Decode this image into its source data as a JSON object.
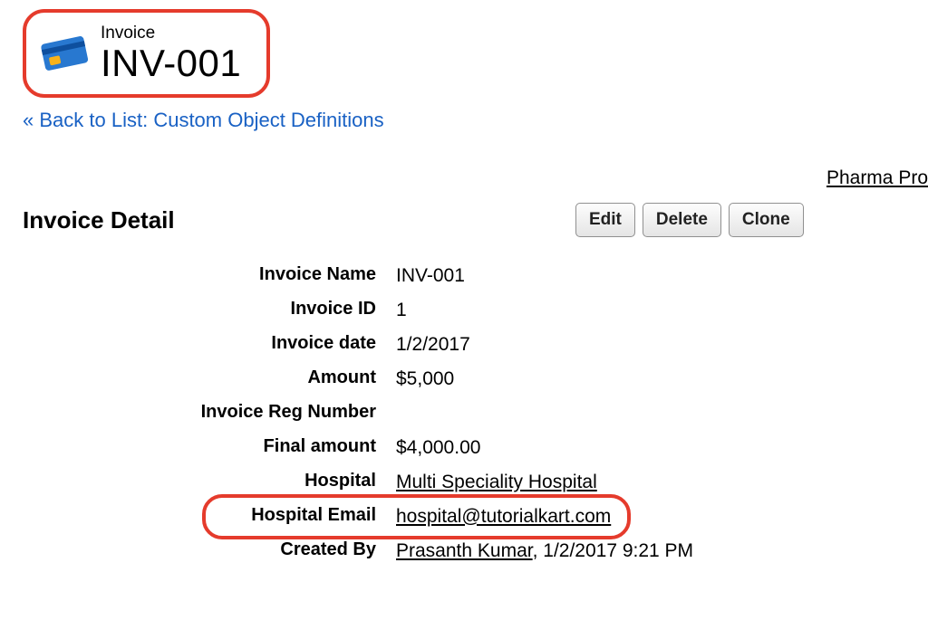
{
  "header": {
    "object_label": "Invoice",
    "record_name": "INV-001"
  },
  "back_link": {
    "chevron": "«",
    "label": "Back to List: Custom Object Definitions"
  },
  "toolbar_link": "Pharma Pro",
  "section_title": "Invoice Detail",
  "buttons": {
    "edit": "Edit",
    "delete": "Delete",
    "clone": "Clone"
  },
  "fields": {
    "invoice_name": {
      "label": "Invoice Name",
      "value": "INV-001"
    },
    "invoice_id": {
      "label": "Invoice ID",
      "value": "1"
    },
    "invoice_date": {
      "label": "Invoice date",
      "value": "1/2/2017"
    },
    "amount": {
      "label": "Amount",
      "value": "$5,000"
    },
    "reg_number": {
      "label": "Invoice Reg Number",
      "value": ""
    },
    "final_amount": {
      "label": "Final amount",
      "value": "$4,000.00"
    },
    "hospital": {
      "label": "Hospital",
      "value": "Multi Speciality Hospital"
    },
    "hospital_email": {
      "label": "Hospital Email",
      "value": "hospital@tutorialkart.com"
    },
    "created_by": {
      "label": "Created By",
      "name": "Prasanth Kumar",
      "rest": ", 1/2/2017 9:21 PM"
    }
  }
}
